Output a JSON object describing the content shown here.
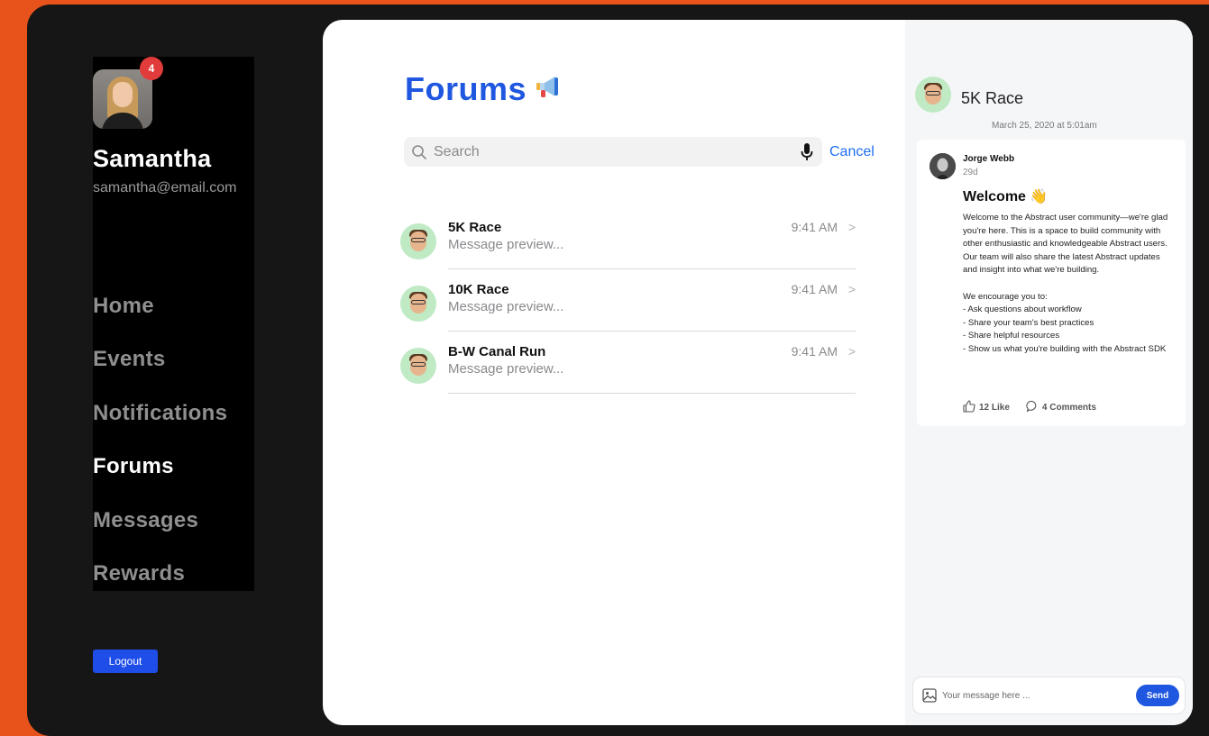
{
  "user": {
    "name": "Samantha",
    "email": "samantha@email.com",
    "notification_count": "4"
  },
  "nav": [
    {
      "label": "Home",
      "active": false
    },
    {
      "label": "Events",
      "active": false
    },
    {
      "label": "Notifications",
      "active": false
    },
    {
      "label": "Forums",
      "active": true
    },
    {
      "label": "Messages",
      "active": false
    },
    {
      "label": "Rewards",
      "active": false
    }
  ],
  "logout_label": "Logout",
  "main": {
    "title": "Forums",
    "title_icon": "megaphone-icon",
    "search_placeholder": "Search",
    "search_value": "",
    "cancel_label": "Cancel",
    "threads": [
      {
        "title": "5K Race",
        "preview": "Message preview...",
        "time": "9:41 AM"
      },
      {
        "title": "10K Race",
        "preview": "Message preview...",
        "time": "9:41 AM"
      },
      {
        "title": "B-W Canal Run",
        "preview": "Message preview...",
        "time": "9:41 AM"
      }
    ]
  },
  "thread_panel": {
    "title": "5K Race",
    "date": "March 25, 2020 at 5:01am",
    "post": {
      "author": "Jorge Webb",
      "age": "29d",
      "title": "Welcome 👋",
      "body": "Welcome to the Abstract user community—we're glad you're here. This is a space to build community with other enthusiastic and knowledgeable Abstract users. Our team will also share the latest Abstract updates and insight into what we're building.\n\nWe encourage you to:\n- Ask questions about workflow\n- Share your team's best practices\n- Share helpful resources\n- Show us what you're building with the Abstract SDK",
      "likes_label": "12 Like",
      "comments_label": "4 Comments"
    },
    "composer": {
      "placeholder": "Your message here ...",
      "send_label": "Send"
    }
  },
  "colors": {
    "background": "#e8531c",
    "accent": "#1f57e0",
    "badge": "#e23b3b"
  }
}
